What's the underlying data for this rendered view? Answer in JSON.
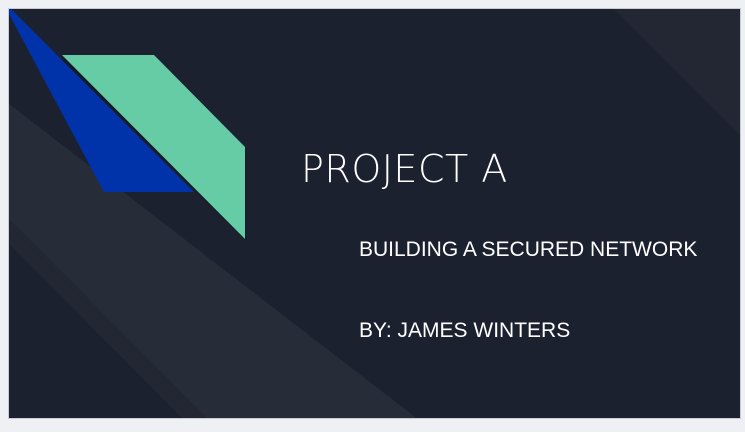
{
  "slide": {
    "title": "PROJECT A",
    "subtitle": "BUILDING A SECURED NETWORK",
    "author": "BY: JAMES WINTERS"
  },
  "colors": {
    "background": "#1c2130",
    "band_light": "#272d38",
    "band_mid": "#222733",
    "accent_blue": "#0033aa",
    "accent_green": "#66cca6",
    "text": "#ffffff"
  }
}
